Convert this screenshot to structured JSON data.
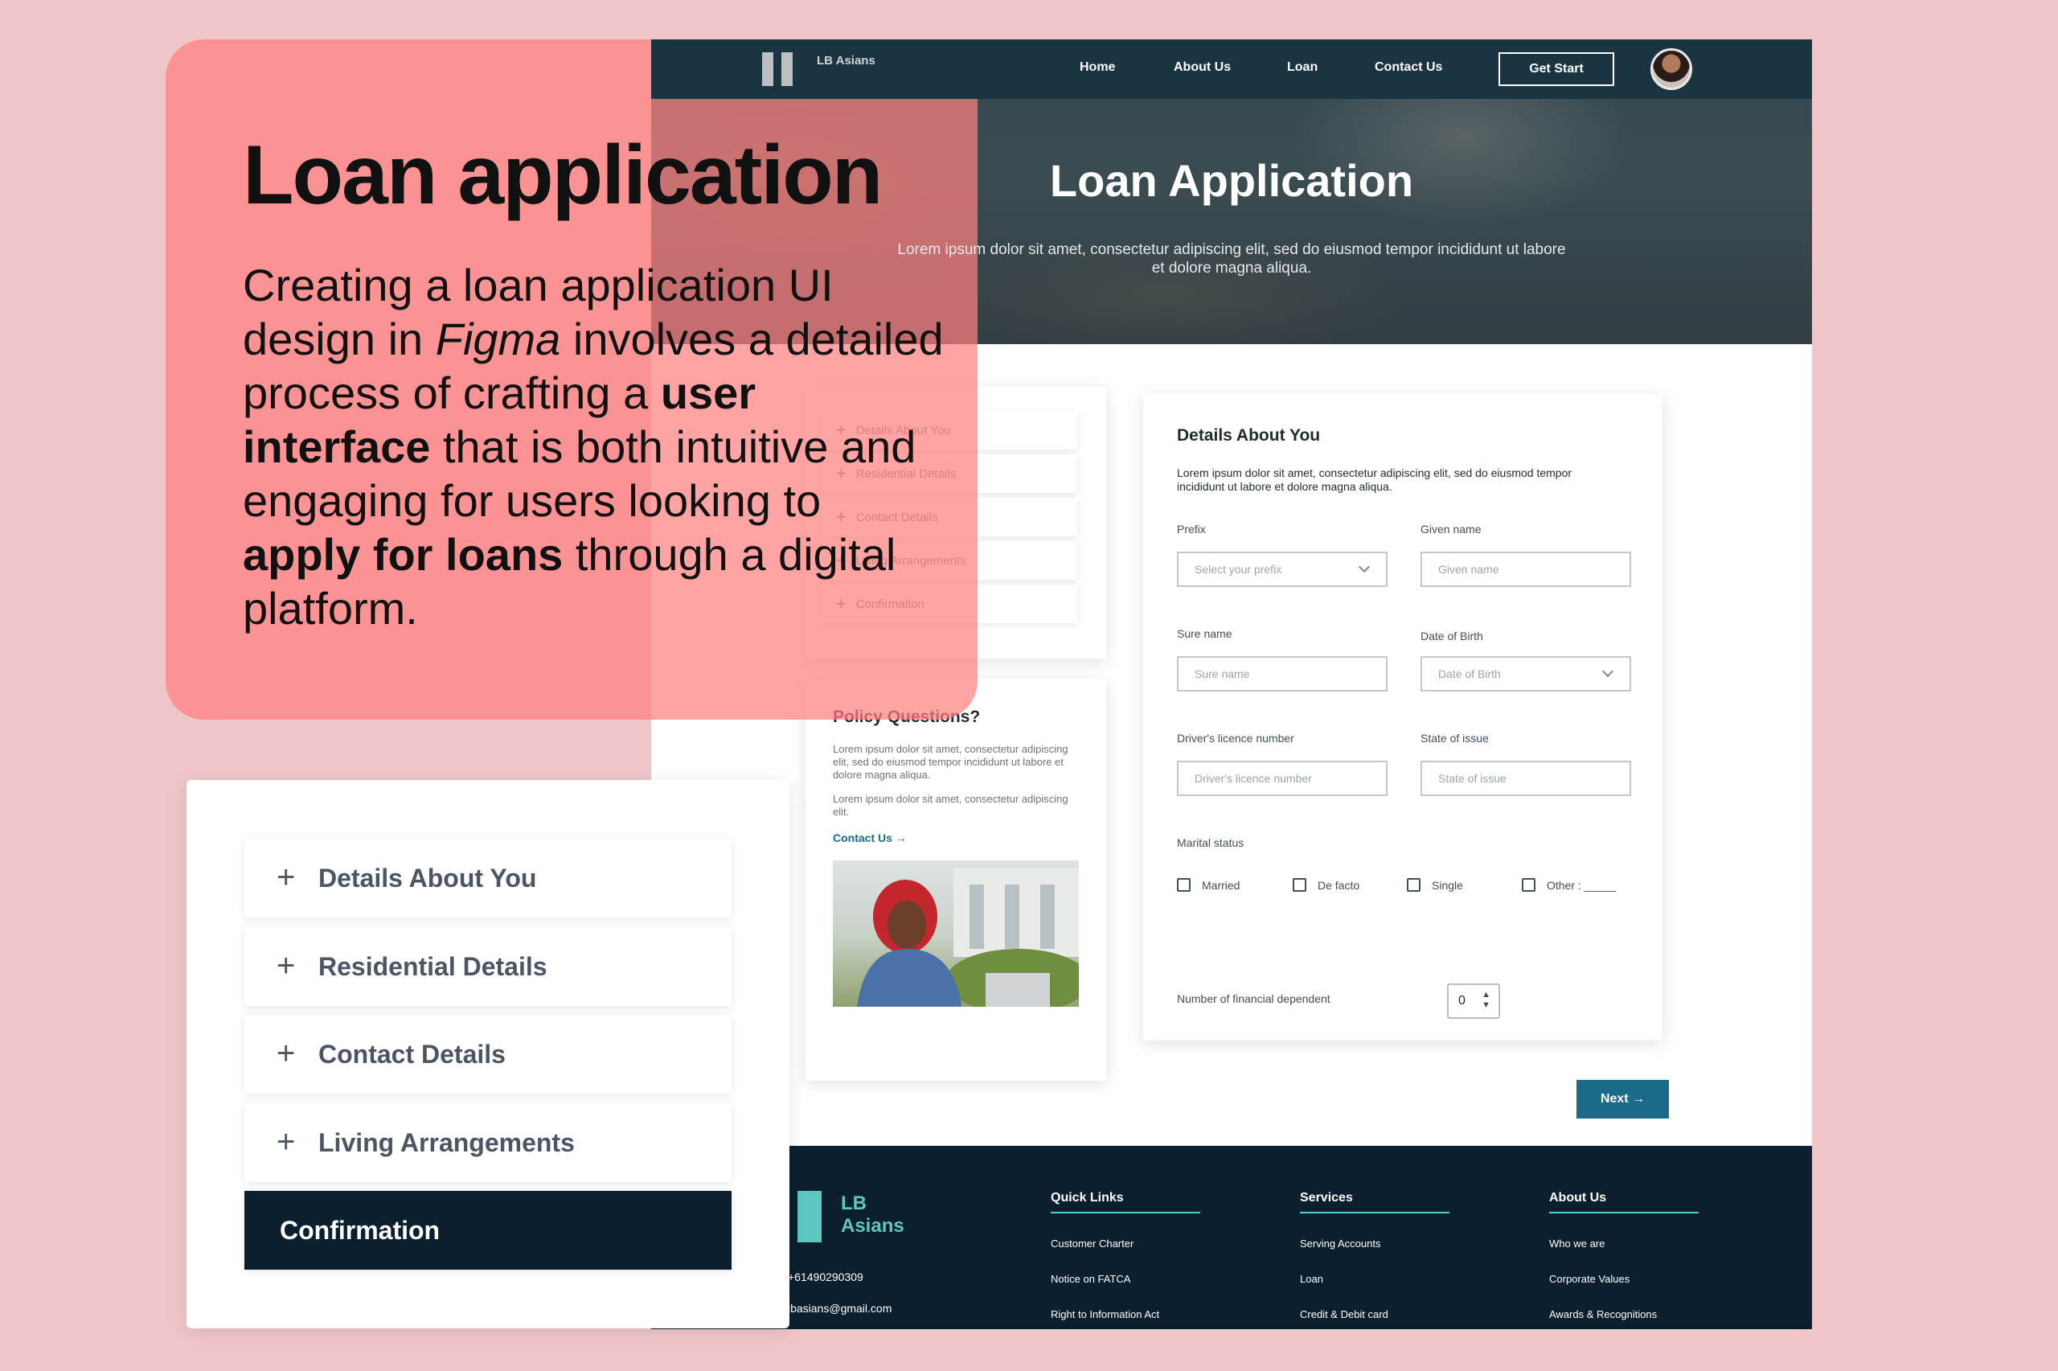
{
  "colors": {
    "background": "#efc6c8",
    "promo": "#ff8080",
    "navy": "#0c1f2e",
    "primary": "#1b6a8a",
    "teal": "#5ec7c1"
  },
  "promo": {
    "title": "Loan application",
    "body_1": "Creating a loan application UI design in ",
    "body_figma": "Figma",
    "body_2": " involves a detailed process of crafting a ",
    "body_bold_1": "user interface",
    "body_3": " that is both intuitive and engaging for users looking to ",
    "body_bold_2": "apply for loans",
    "body_4": " through a digital platform."
  },
  "nav": {
    "brand": "LB Asians",
    "links": [
      "Home",
      "About Us",
      "Loan",
      "Contact Us"
    ],
    "cta": "Get Start"
  },
  "hero": {
    "title": "Loan Application",
    "subtitle": "Lorem ipsum dolor sit amet, consectetur adipiscing elit, sed do eiusmod tempor incididunt ut labore et dolore magna aliqua."
  },
  "steps": [
    "Details About You",
    "Residential Details",
    "Contact Details",
    "Living Arrangements",
    "Confirmation"
  ],
  "policy": {
    "title": "Policy Questions?",
    "para1": "Lorem ipsum dolor sit amet, consectetur adipiscing elit, sed do eiusmod tempor incididunt ut labore et dolore magna aliqua.",
    "para2": "Lorem ipsum dolor sit amet, consectetur adipiscing elit.",
    "link": "Contact Us →"
  },
  "form": {
    "title": "Details About You",
    "intro": "Lorem ipsum dolor sit amet, consectetur adipiscing elit, sed do eiusmod tempor incididunt ut labore et dolore magna aliqua.",
    "prefix_label": "Prefix",
    "prefix_placeholder": "Select your prefix",
    "given_label": "Given name",
    "given_placeholder": "Given name",
    "surname_label": "Sure name",
    "surname_placeholder": "Sure name",
    "dob_label": "Date of Birth",
    "dob_placeholder": "Date of Birth",
    "licence_label": "Driver's licence number",
    "licence_placeholder": "Driver's licence number",
    "state_label": "State of issue",
    "state_placeholder": "State of issue",
    "marital_label": "Marital status",
    "marital_options": [
      "Married",
      "De facto",
      "Single",
      "Other : _____"
    ],
    "dependents_label": "Number of financial dependent",
    "dependents_value": "0",
    "next": "Next →"
  },
  "footer": {
    "brand_line1": "LB",
    "brand_line2": "Asians",
    "phone": "+61490290309",
    "email": "lbasians@gmail.com",
    "columns": [
      {
        "title": "Quick Links",
        "links": [
          "Customer Charter",
          "Notice on FATCA",
          "Right to Information Act"
        ]
      },
      {
        "title": "Services",
        "links": [
          "Serving Accounts",
          "Loan",
          "Credit & Debit card"
        ]
      },
      {
        "title": "About Us",
        "links": [
          "Who we are",
          "Corporate Values",
          "Awards & Recognitions"
        ]
      }
    ]
  }
}
